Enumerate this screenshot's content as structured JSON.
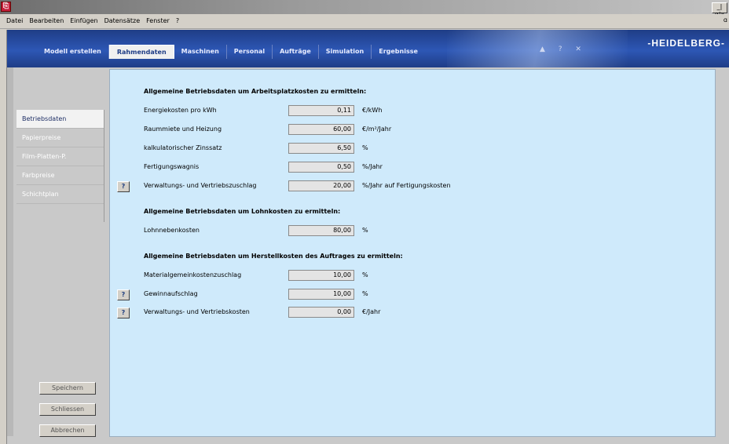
{
  "window": {
    "controls": "_|ɑ|x"
  },
  "menu": [
    "Datei",
    "Bearbeiten",
    "Einfügen",
    "Datensätze",
    "Fenster",
    "?"
  ],
  "header": {
    "logo": "-HEIDELBERG-",
    "tabs": [
      "Modell erstellen",
      "Rahmendaten",
      "Maschinen",
      "Personal",
      "Aufträge",
      "Simulation",
      "Ergebnisse"
    ],
    "active_tab": "Rahmendaten",
    "help_icons": "▲ ? ✕"
  },
  "sidebar": {
    "items": [
      "Betriebsdaten",
      "Papierpreise",
      "Film-Platten-P.",
      "Farbpreise",
      "Schichtplan"
    ],
    "active": "Betriebsdaten"
  },
  "sections": [
    {
      "title": "Allgemeine Betriebsdaten um Arbeitsplatzkosten zu ermitteln:",
      "rows": [
        {
          "label": "Energiekosten pro kWh",
          "value": "0,11",
          "unit": "€/kWh",
          "help": false
        },
        {
          "label": "Raummiete und Heizung",
          "value": "60,00",
          "unit": "€/m²/Jahr",
          "help": false
        },
        {
          "label": "kalkulatorischer Zinssatz",
          "value": "6,50",
          "unit": "%",
          "help": false
        },
        {
          "label": "Fertigungswagnis",
          "value": "0,50",
          "unit": "%/Jahr",
          "help": false
        },
        {
          "label": "Verwaltungs- und Vertriebszuschlag",
          "value": "20,00",
          "unit": "%/Jahr auf Fertigungskosten",
          "help": true
        }
      ]
    },
    {
      "title": "Allgemeine Betriebsdaten um Lohnkosten zu ermitteln:",
      "rows": [
        {
          "label": "Lohnnebenkosten",
          "value": "80,00",
          "unit": "%",
          "help": false
        }
      ]
    },
    {
      "title": "Allgemeine Betriebsdaten um Herstellkosten des Auftrages zu ermitteln:",
      "rows": [
        {
          "label": "Materialgemeinkostenzuschlag",
          "value": "10,00",
          "unit": "%",
          "help": false
        },
        {
          "label": "Gewinnaufschlag",
          "value": "10,00",
          "unit": "%",
          "help": true
        },
        {
          "label": "Verwaltungs- und Vertriebskosten",
          "value": "0,00",
          "unit": "€/Jahr",
          "help": true
        }
      ]
    }
  ],
  "help_button_label": "?",
  "buttons": {
    "save": "Speichern",
    "close": "Schliessen",
    "cancel": "Abbrechen"
  }
}
